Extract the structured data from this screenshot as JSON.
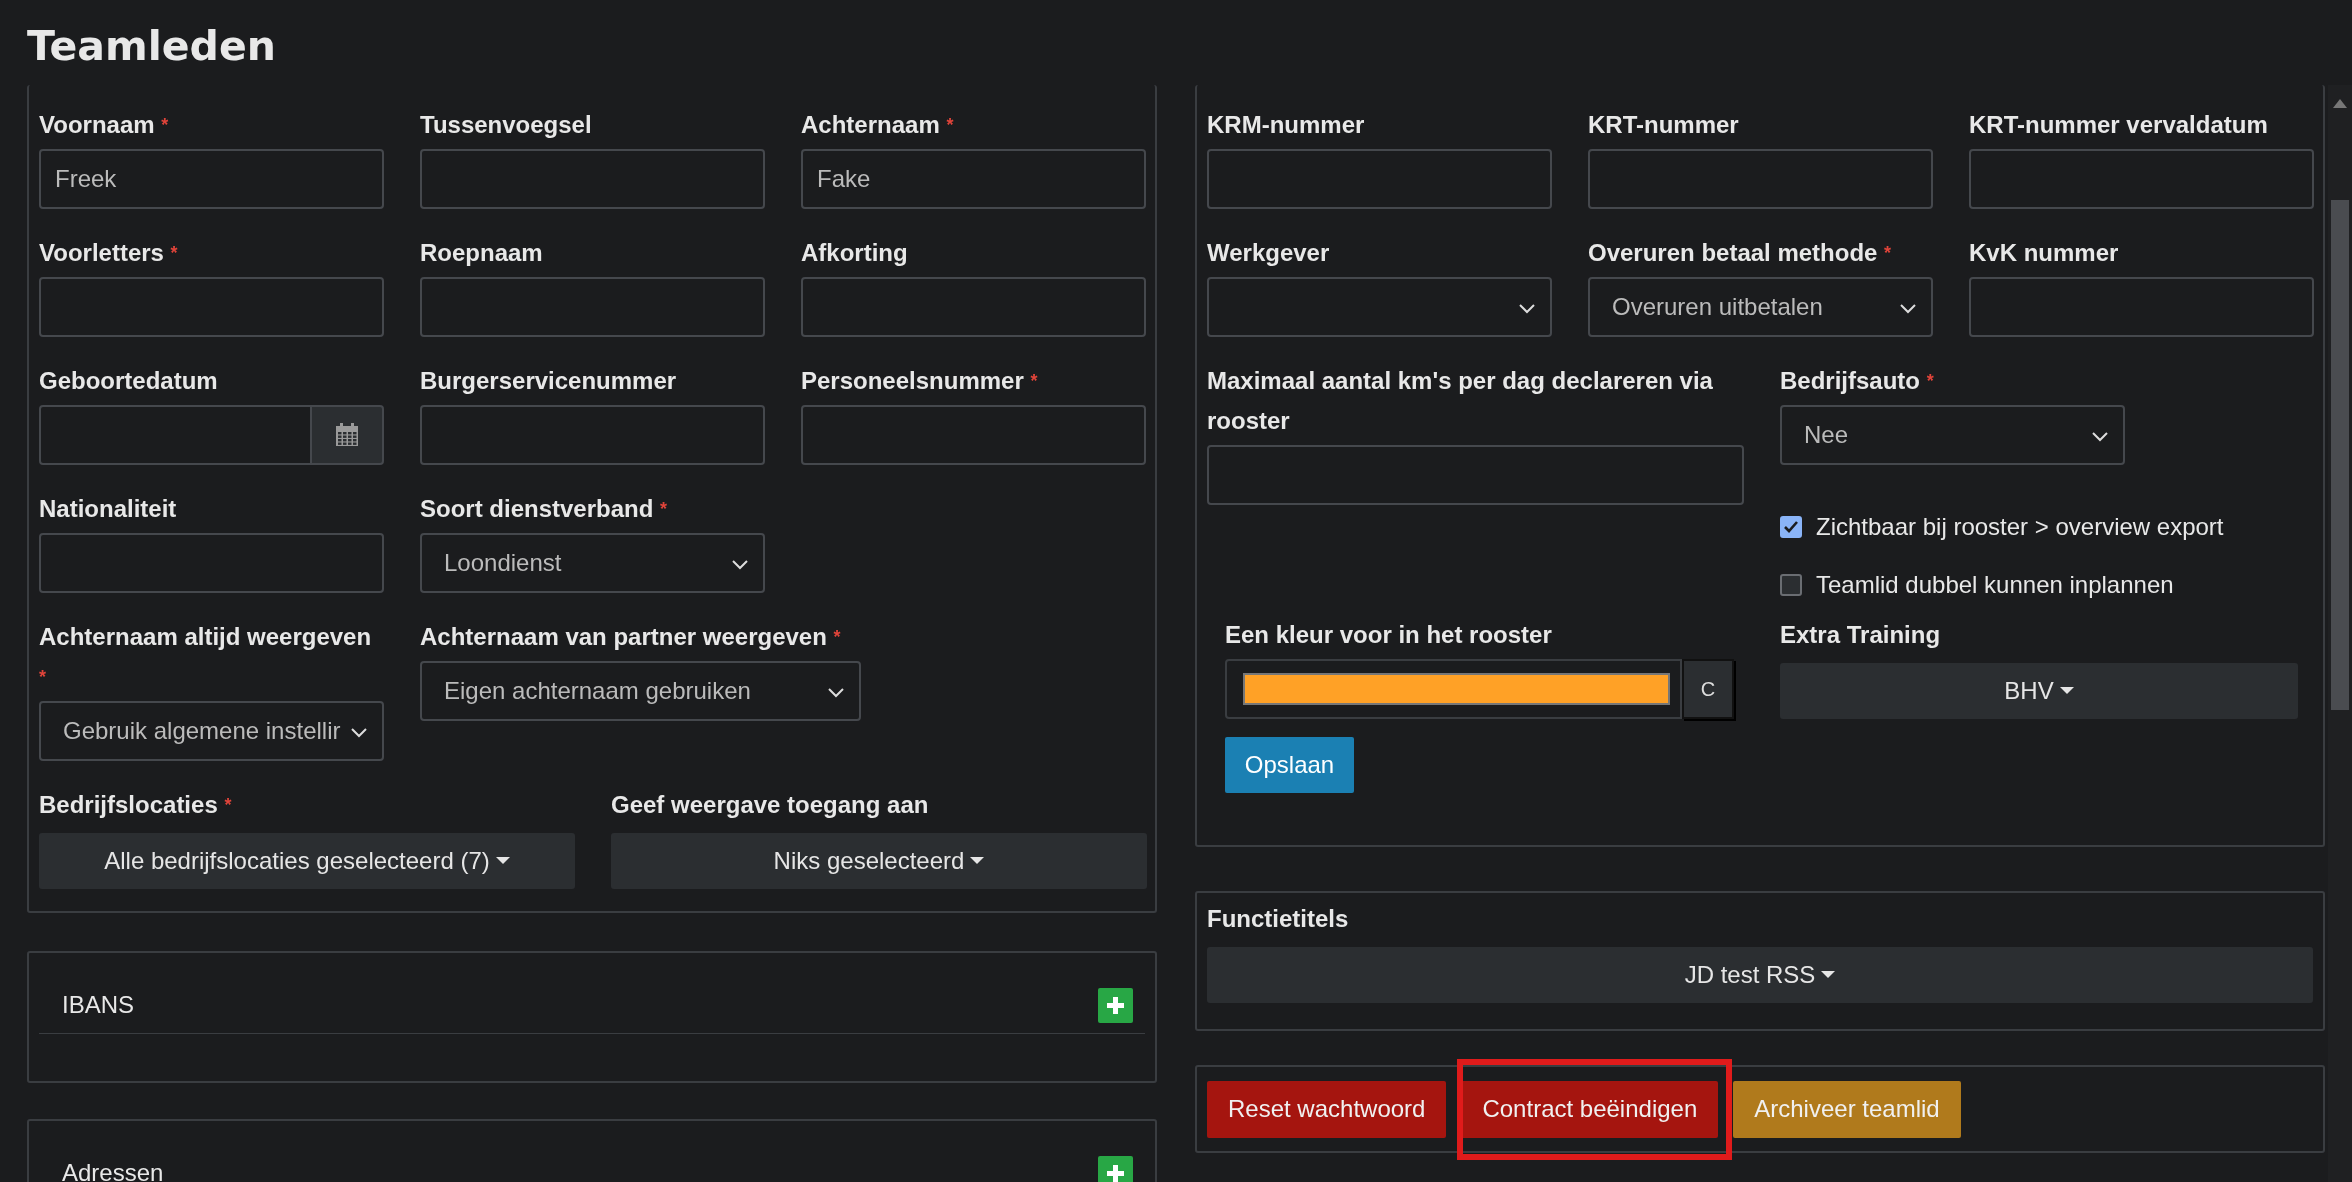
{
  "title": "Teamleden",
  "left_panel": {
    "rows": [
      [
        {
          "kind": "text",
          "label": "Voornaam",
          "marker": "*",
          "value": "Freek"
        },
        {
          "kind": "text",
          "label": "Tussenvoegsel"
        },
        {
          "kind": "text",
          "label": "Achternaam",
          "marker": "*",
          "value": "Fake"
        }
      ],
      [
        {
          "kind": "text",
          "label": "Voorletters",
          "marker": "*"
        },
        {
          "kind": "text",
          "label": "Roepnaam"
        },
        {
          "kind": "text",
          "label": "Afkorting"
        }
      ],
      [
        {
          "kind": "date",
          "label": "Geboortedatum"
        },
        {
          "kind": "text",
          "label": "Burgerservicenummer"
        },
        {
          "kind": "text",
          "label": "Personeelsnummer",
          "marker": "*"
        }
      ],
      [
        {
          "kind": "text",
          "label": "Nationaliteit"
        },
        {
          "kind": "select",
          "label": "Soort dienstverband",
          "marker": "*",
          "value": "Loondienst"
        }
      ],
      [
        {
          "kind": "select",
          "label": "Achternaam altijd weergeven",
          "marker": "*",
          "value": "Gebruik algemene instellir"
        },
        {
          "kind": "select",
          "label": "Achternaam van partner weergeven",
          "marker": "*",
          "value": "Eigen achternaam gebruiken"
        }
      ],
      [
        {
          "kind": "dropdown",
          "label": "Bedrijfslocaties",
          "marker": "*",
          "value": "Alle bedrijfslocaties geselecteerd (7)"
        },
        {
          "kind": "dropdown",
          "label": "Geef weergave toegang aan",
          "value": "Niks geselecteerd"
        }
      ]
    ]
  },
  "sections": [
    {
      "title": "IBANS"
    },
    {
      "title": "Adressen"
    }
  ],
  "right_panel": {
    "rows": [
      [
        {
          "kind": "text",
          "label": "KRM-nummer"
        },
        {
          "kind": "text",
          "label": "KRT-nummer"
        },
        {
          "kind": "text",
          "label": "KRT-nummer vervaldatum"
        }
      ],
      [
        {
          "kind": "select",
          "label": "Werkgever"
        },
        {
          "kind": "select",
          "label": "Overuren betaal methode",
          "marker": "*",
          "value": "Overuren uitbetalen"
        },
        {
          "kind": "text",
          "label": "KvK nummer"
        }
      ]
    ],
    "km_field": {
      "kind": "text",
      "label": "Maximaal aantal km's per dag declareren via rooster"
    },
    "company_car": {
      "kind": "select",
      "label": "Bedrijfsauto",
      "marker": "*",
      "value": "Nee"
    },
    "checkboxes": [
      {
        "label": "Zichtbaar bij rooster > overview export",
        "checked": true
      },
      {
        "label": "Teamlid dubbel kunnen inplannen",
        "checked": false
      }
    ],
    "color_picker": {
      "label": "Een kleur voor in het rooster",
      "color": "#ffa126",
      "button": "C"
    },
    "extra_training": {
      "kind": "dropdown",
      "label": "Extra Training",
      "value": "BHV"
    },
    "save_button": "Opslaan"
  },
  "functietitels": {
    "label": "Functietitels",
    "value": "JD test RSS"
  },
  "actions": [
    {
      "label": "Reset wachtwoord",
      "kind": "danger",
      "highlighted": false
    },
    {
      "label": "Contract beëindigen",
      "kind": "danger",
      "highlighted": true
    },
    {
      "label": "Archiveer teamlid",
      "kind": "warning",
      "highlighted": false
    }
  ]
}
